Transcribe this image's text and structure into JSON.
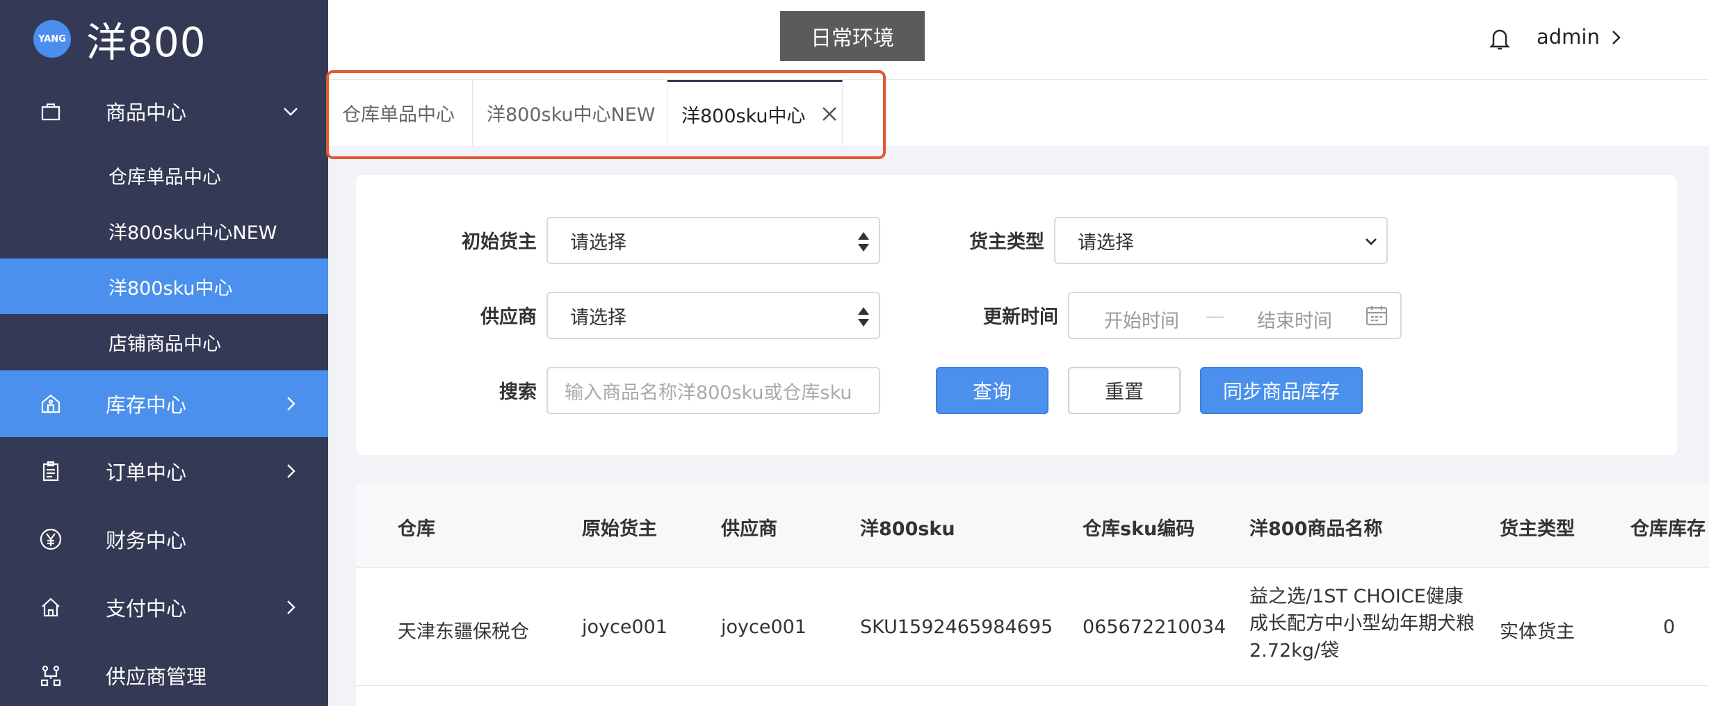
{
  "brand": {
    "badge": "YANG",
    "name": "洋800"
  },
  "sidebar": {
    "product_center": "商品中心",
    "sub_items": [
      "仓库单品中心",
      "洋800sku中心NEW",
      "洋800sku中心",
      "店铺商品中心"
    ],
    "inventory_center": "库存中心",
    "order_center": "订单中心",
    "finance_center": "财务中心",
    "payment_center": "支付中心",
    "supplier_mgmt": "供应商管理"
  },
  "header": {
    "env": "日常环境",
    "user": "admin"
  },
  "tabs": [
    "仓库单品中心",
    "洋800sku中心NEW",
    "洋800sku中心"
  ],
  "filters": {
    "owner_label": "初始货主",
    "owner_value": "请选择",
    "owner_type_label": "货主类型",
    "owner_type_value": "请选择",
    "supplier_label": "供应商",
    "supplier_value": "请选择",
    "update_time_label": "更新时间",
    "start_placeholder": "开始时间",
    "range_sep": "—",
    "end_placeholder": "结束时间",
    "search_label": "搜索",
    "search_placeholder": "输入商品名称洋800sku或仓库sku"
  },
  "buttons": {
    "query": "查询",
    "reset": "重置",
    "sync": "同步商品库存"
  },
  "table": {
    "columns": [
      "仓库",
      "原始货主",
      "供应商",
      "洋800sku",
      "仓库sku编码",
      "洋800商品名称",
      "货主类型",
      "仓库库存"
    ],
    "rows": [
      {
        "warehouse": "天津东疆保税仓",
        "original_owner": "joyce001",
        "supplier": "joyce001",
        "sku": "SKU1592465984695",
        "warehouse_sku": "065672210034",
        "product_name": "益之选/1ST CHOICE健康成长配方中小型幼年期犬粮 2.72kg/袋",
        "owner_type": "实体货主",
        "stock": "0"
      }
    ]
  },
  "colors": {
    "sidebar": "#343a55",
    "accent": "#4a90ec",
    "highlight": "#e05a34"
  }
}
